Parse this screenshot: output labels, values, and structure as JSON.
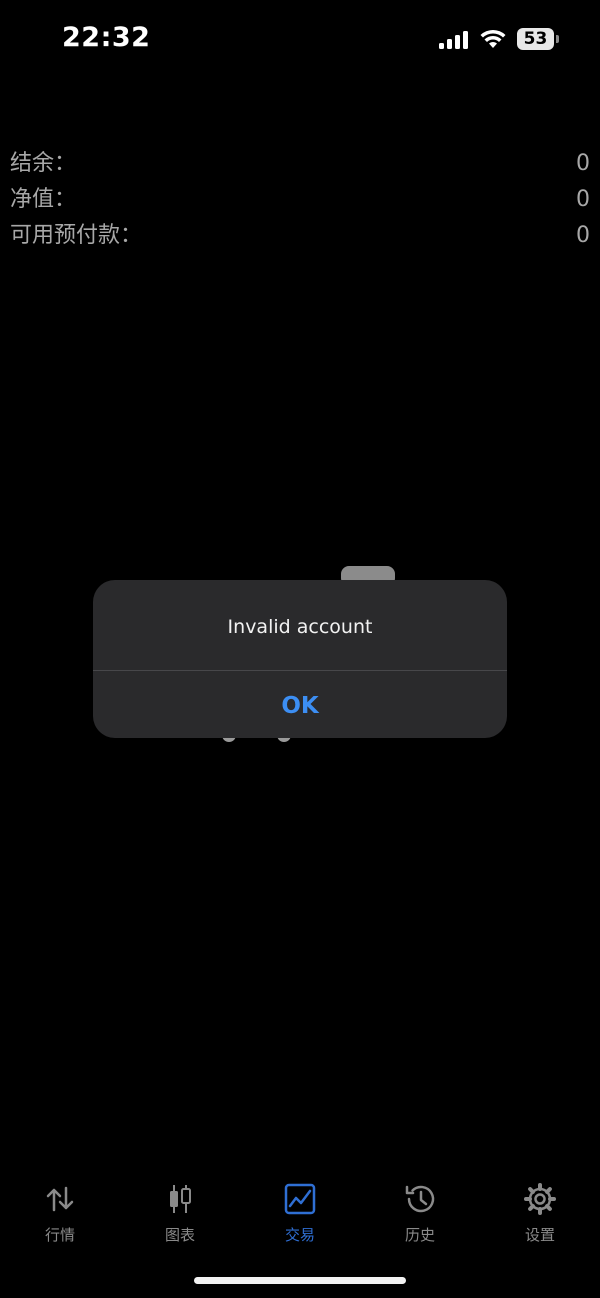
{
  "status_bar": {
    "time": "22:32",
    "battery_level": "53"
  },
  "account": {
    "rows": [
      {
        "label": "结余：",
        "value": "0"
      },
      {
        "label": "净值：",
        "value": "0"
      },
      {
        "label": "可用预付款：",
        "value": "0"
      }
    ]
  },
  "alert": {
    "message": "Invalid account",
    "ok_label": "OK"
  },
  "tabs": [
    {
      "label": "行情",
      "icon": "quotes-arrows-icon",
      "active": false
    },
    {
      "label": "图表",
      "icon": "candlestick-chart-icon",
      "active": false
    },
    {
      "label": "交易",
      "icon": "trade-chart-icon",
      "active": true
    },
    {
      "label": "历史",
      "icon": "history-clock-icon",
      "active": false
    },
    {
      "label": "设置",
      "icon": "settings-gear-icon",
      "active": false
    }
  ],
  "colors": {
    "accent": "#3c8ef3",
    "active_tab": "#2f6fd4",
    "inactive_tab": "#8a8a8a",
    "background": "#000000",
    "alert_background": "#2a2a2c"
  }
}
